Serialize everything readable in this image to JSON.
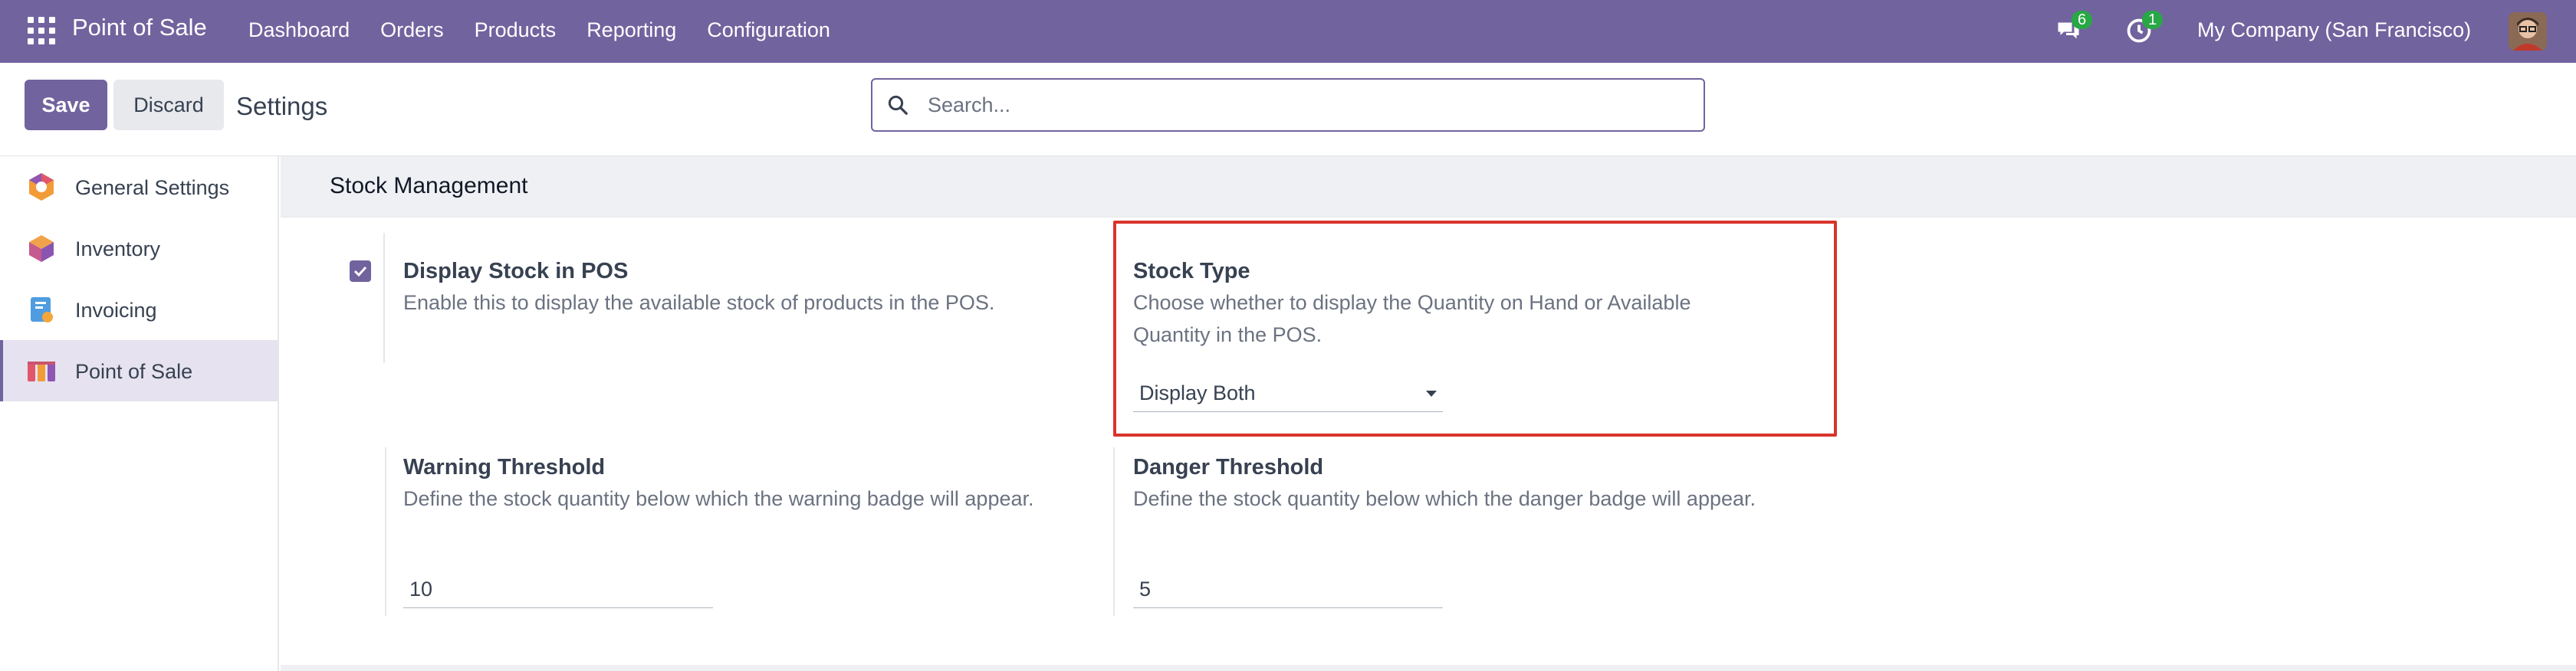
{
  "navbar": {
    "app_name": "Point of Sale",
    "menu": [
      "Dashboard",
      "Orders",
      "Products",
      "Reporting",
      "Configuration"
    ],
    "messages_count": "6",
    "activities_count": "1",
    "company": "My Company (San Francisco)"
  },
  "control": {
    "save_label": "Save",
    "discard_label": "Discard",
    "title": "Settings",
    "search_placeholder": "Search..."
  },
  "sidebar": {
    "items": [
      {
        "label": "General Settings",
        "icon": "odoo-settings-icon"
      },
      {
        "label": "Inventory",
        "icon": "inventory-icon"
      },
      {
        "label": "Invoicing",
        "icon": "invoicing-icon"
      },
      {
        "label": "Point of Sale",
        "icon": "point-of-sale-icon",
        "active": true
      }
    ]
  },
  "section": {
    "title": "Stock Management",
    "display_stock": {
      "title": "Display Stock in POS",
      "description": "Enable this to display the available stock of products in the POS.",
      "checked": true
    },
    "stock_type": {
      "title": "Stock Type",
      "description": "Choose whether to display the Quantity on Hand or Available Quantity in the POS.",
      "value": "Display Both"
    },
    "warning_threshold": {
      "title": "Warning Threshold",
      "description": "Define the stock quantity below which the warning badge will appear.",
      "value": "10"
    },
    "danger_threshold": {
      "title": "Danger Threshold",
      "description": "Define the stock quantity below which the danger badge will appear.",
      "value": "5"
    }
  },
  "colors": {
    "brand": "#71639e",
    "highlight": "#d9342b",
    "badge": "#28a745"
  }
}
